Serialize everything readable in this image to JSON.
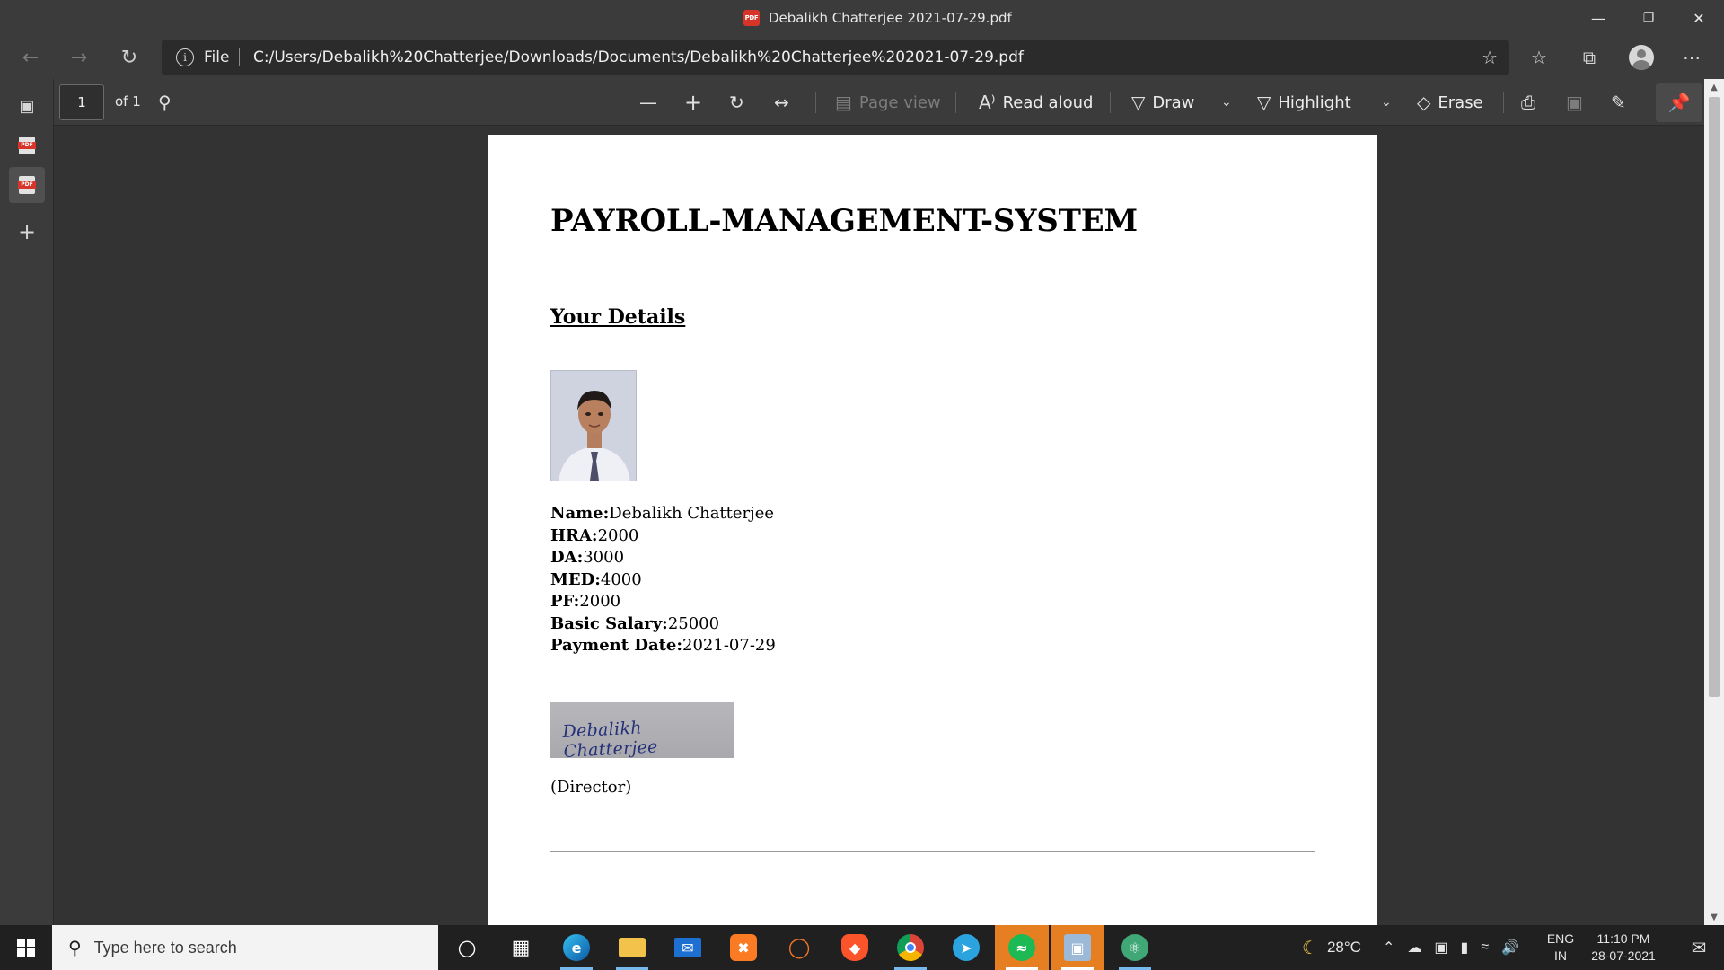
{
  "window": {
    "title": "Debalikh Chatterjee 2021-07-29.pdf",
    "minimize_icon": "minimize-icon",
    "restore_icon": "restore-icon",
    "close_icon": "close-icon"
  },
  "address_bar": {
    "scheme_label": "File",
    "url": "C:/Users/Debalikh%20Chatterjee/Downloads/Documents/Debalikh%20Chatterjee%202021-07-29.pdf"
  },
  "pdf_toolbar": {
    "page_number": "1",
    "page_count": "of 1",
    "page_view": "Page view",
    "read_aloud": "Read aloud",
    "draw": "Draw",
    "highlight": "Highlight",
    "erase": "Erase"
  },
  "document": {
    "title": "PAYROLL-MANAGEMENT-SYSTEM",
    "subtitle": "Your Details",
    "fields": [
      {
        "label": "Name:",
        "value": "Debalikh Chatterjee"
      },
      {
        "label": "HRA:",
        "value": "2000"
      },
      {
        "label": "DA:",
        "value": "3000"
      },
      {
        "label": "MED:",
        "value": "4000"
      },
      {
        "label": "PF:",
        "value": "2000"
      },
      {
        "label": "Basic Salary:",
        "value": "25000"
      },
      {
        "label": "Payment Date:",
        "value": "2021-07-29"
      }
    ],
    "signature_text": "Debalikh Chatterjee",
    "signer_role": "(Director)"
  },
  "taskbar": {
    "search_placeholder": "Type here to search",
    "weather": "28°C",
    "lang_top": "ENG",
    "lang_bottom": "IN",
    "time": "11:10 PM",
    "date": "28-07-2021"
  },
  "colors": {
    "chrome": "#3b3b3b",
    "viewer_bg": "#333333",
    "accent": "#76b9ed",
    "pdf_red": "#d8352a",
    "highlight_taskbar": "#e67e22"
  }
}
